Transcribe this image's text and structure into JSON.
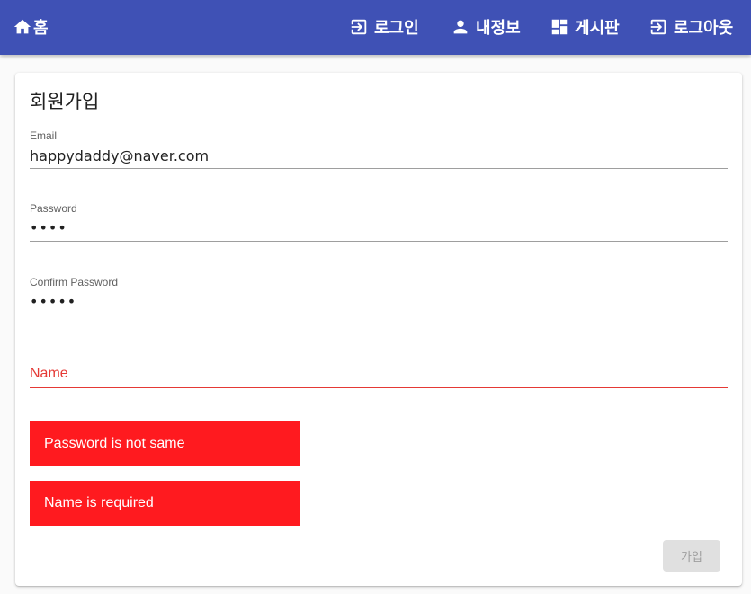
{
  "colors": {
    "appbar": "#3f51b5",
    "error": "#e53935",
    "alert_bg": "#ff1a1f",
    "button_disabled_bg": "#e0e0e0"
  },
  "nav": {
    "home": {
      "icon": "home-icon",
      "label": "홈"
    },
    "items": [
      {
        "icon": "login-icon",
        "label": "로그인"
      },
      {
        "icon": "person-icon",
        "label": "내정보"
      },
      {
        "icon": "dashboard-icon",
        "label": "게시판"
      },
      {
        "icon": "logout-icon",
        "label": "로그아웃"
      }
    ]
  },
  "form": {
    "title": "회원가입",
    "email": {
      "label": "Email",
      "value": "happydaddy@naver.com"
    },
    "password": {
      "label": "Password",
      "value": "••••"
    },
    "confirm_password": {
      "label": "Confirm Password",
      "value": "•••••"
    },
    "name": {
      "label": "Name",
      "value": ""
    },
    "errors": [
      "Password is not same",
      "Name is required"
    ],
    "submit_label": "가입"
  }
}
